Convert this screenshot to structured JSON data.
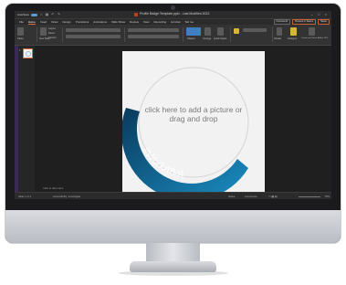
{
  "app": {
    "title": "Profile Badge Template.pptx - Last Modified 2022",
    "autosave_label": "AutoSave",
    "window_controls": "–  □  ×"
  },
  "menu": {
    "items": [
      "File",
      "Home",
      "Insert",
      "Draw",
      "Design",
      "Transitions",
      "Animations",
      "Slide Show",
      "Review",
      "View",
      "Recording",
      "Acrobat",
      "Tell me"
    ],
    "active_index": 1,
    "right_buttons": [
      "Comments",
      "Present in Teams",
      "Share"
    ]
  },
  "ribbon": {
    "group_labels": [
      "Paste",
      "New Slide",
      "Layout",
      "Reset",
      "Section",
      "Shapes",
      "Arrange",
      "Quick Styles",
      "Dictate",
      "Designer",
      "Create and Share Adobe PDF"
    ]
  },
  "slides_panel": {
    "slide_number": "1"
  },
  "slide": {
    "placeholder_text": "click here to add a picture or drag and drop",
    "ring_text": "#WorkAtVA",
    "ring_color_start": "#0a3a5c",
    "ring_color_end": "#1a8fc4"
  },
  "status": {
    "left": "Slide 1 of 1",
    "accessibility": "Accessibility: Investigate",
    "notes_hint": "Click to add notes",
    "notes_label": "Notes",
    "comments_label": "Comments",
    "zoom": "75%"
  },
  "colors": {
    "accent": "#e0683a",
    "screen_bg": "#2b2b2b"
  }
}
